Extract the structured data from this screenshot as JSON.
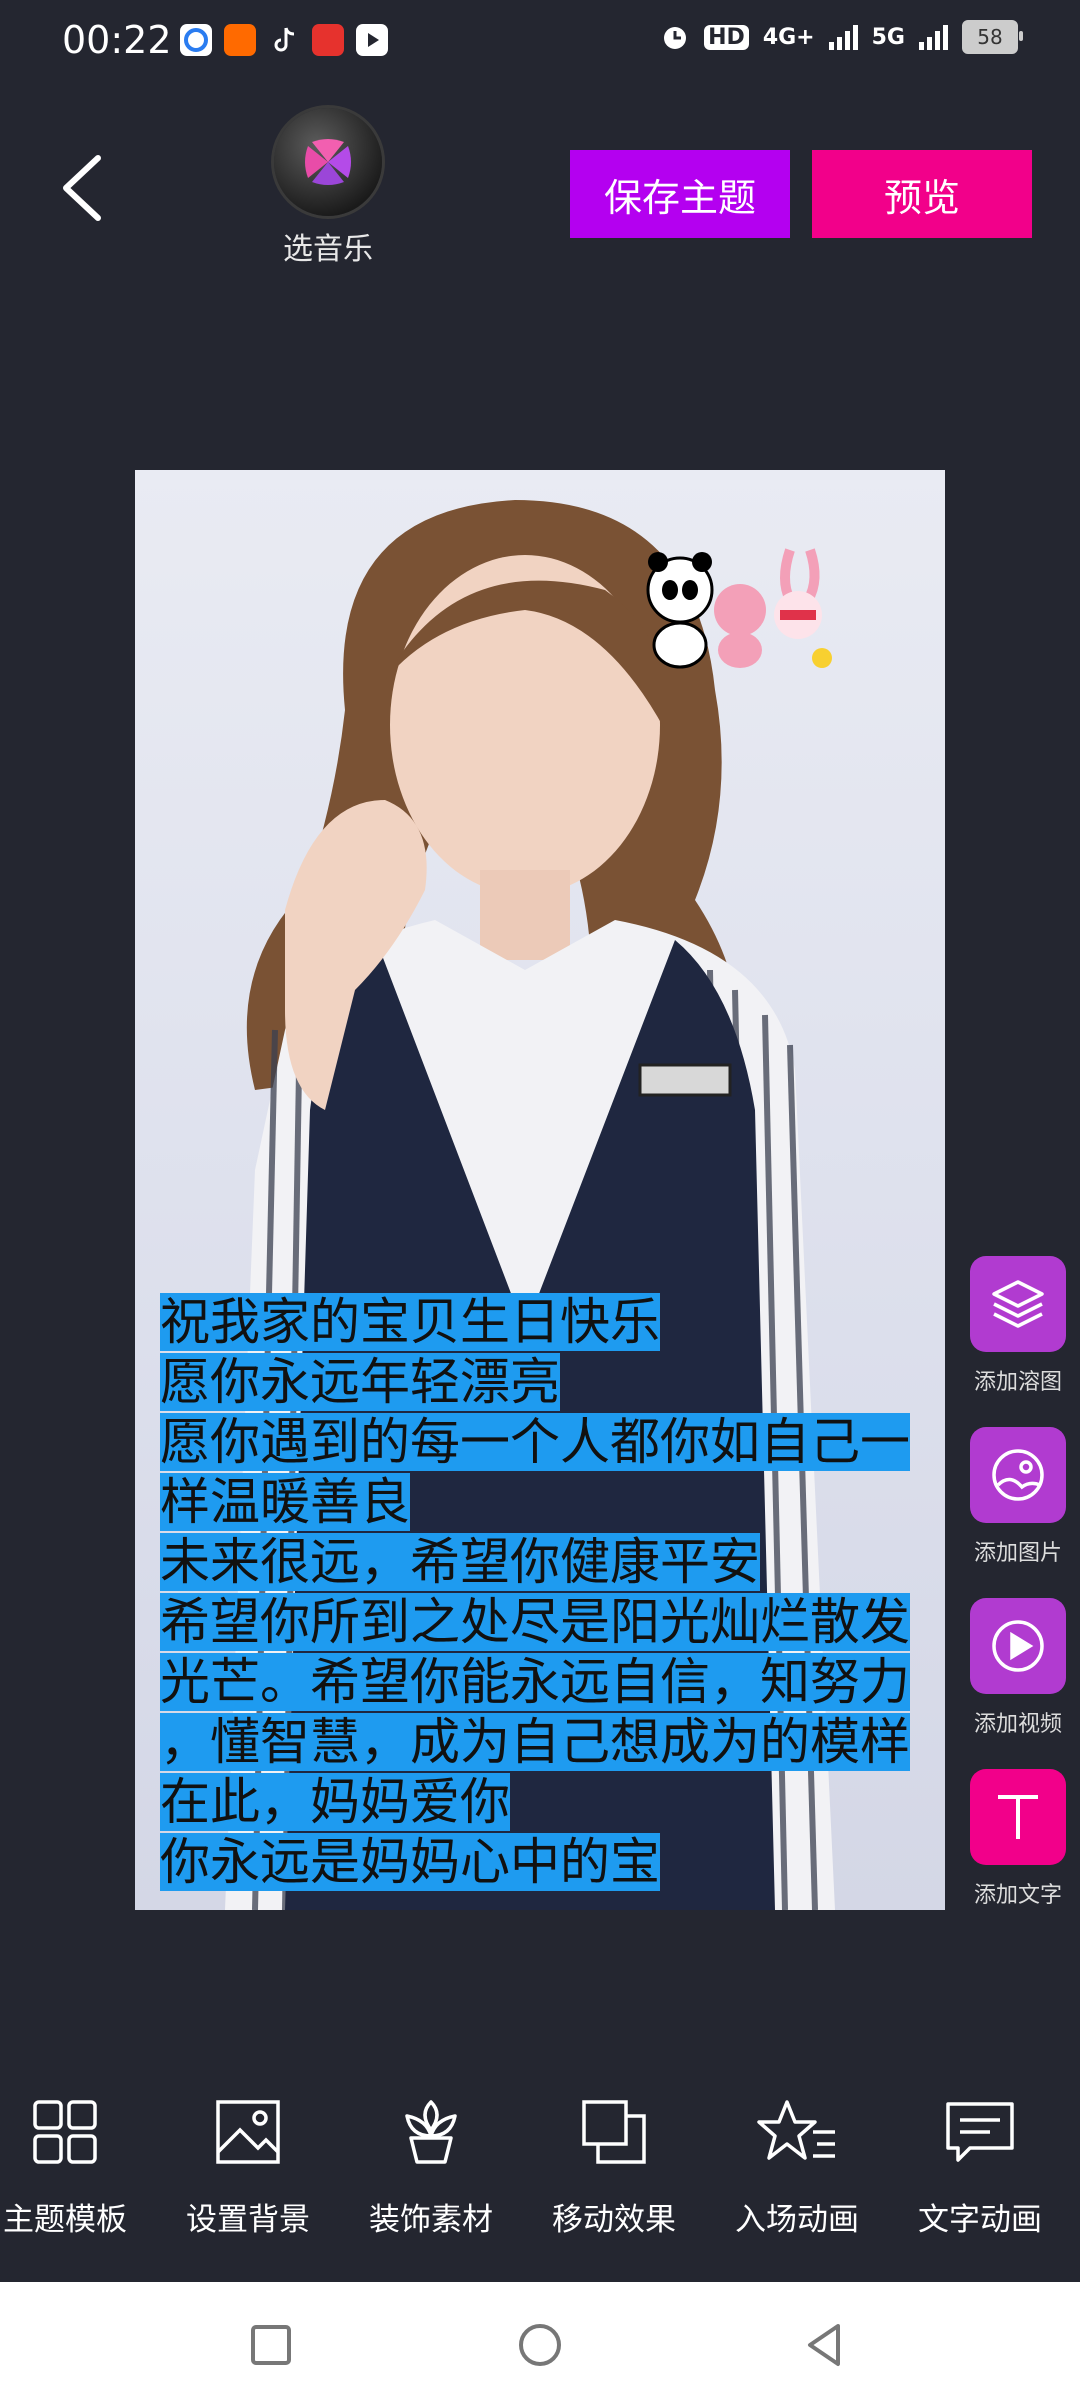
{
  "status_bar": {
    "time": "00:22",
    "network_1": "HD",
    "network_2": "4G+",
    "network_3": "5G",
    "battery": "58"
  },
  "header": {
    "music_label": "选音乐",
    "save_theme_label": "保存主题",
    "preview_label": "预览"
  },
  "canvas": {
    "text_lines": [
      "祝我家的宝贝生日快乐",
      "愿你永远年轻漂亮",
      "愿你遇到的每一个人都你如自己一",
      "样温暖善良",
      "未来很远，希望你健康平安",
      "希望你所到之处尽是阳光灿烂散发",
      "光芒。希望你能永远自信，知努力",
      "，懂智慧，成为自己想成为的模样",
      "在此，妈妈爱你",
      "你永远是妈妈心中的宝"
    ]
  },
  "side_tools": [
    {
      "label": "添加溶图",
      "icon": "layers-icon",
      "color": "#b13bd0"
    },
    {
      "label": "添加图片",
      "icon": "image-icon",
      "color": "#b13bd0"
    },
    {
      "label": "添加视频",
      "icon": "play-icon",
      "color": "#b13bd0"
    },
    {
      "label": "添加文字",
      "icon": "text-icon",
      "color": "#f2008a"
    }
  ],
  "toolbar": [
    {
      "label": "主题模板",
      "icon": "grid-icon"
    },
    {
      "label": "设置背景",
      "icon": "picture-icon"
    },
    {
      "label": "装饰素材",
      "icon": "flower-icon"
    },
    {
      "label": "移动效果",
      "icon": "move-squares-icon"
    },
    {
      "label": "入场动画",
      "icon": "star-icon"
    },
    {
      "label": "文字动画",
      "icon": "chat-icon"
    }
  ],
  "colors": {
    "background": "#242630",
    "save_button": "#b400f0",
    "preview_button": "#f2008a",
    "text_highlight": "#1e9bf0"
  }
}
